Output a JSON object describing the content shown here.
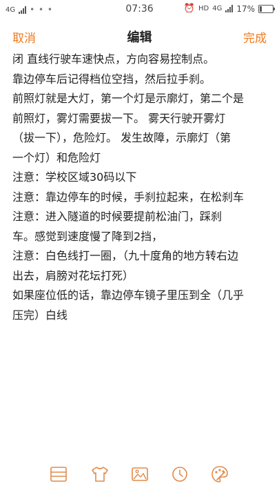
{
  "status_bar": {
    "network_left": "4G",
    "time": "07:36",
    "hd": "HD",
    "network_right": "4G",
    "battery": "17%",
    "battery_level": 0.17
  },
  "nav": {
    "cancel_label": "取消",
    "title": "编辑",
    "done_label": "完成"
  },
  "note": {
    "lines": [
      "闭 直线行驶车速快点，方向容易控制点。",
      "靠边停车后记得档位空挡，然后拉手刹。",
      "前照灯就是大灯，第一个灯是示廓灯，第二个是",
      "前照灯，雾灯需要拔一下。 雾天行驶开雾灯",
      "（拔一下），危险灯。 发生故障，示廓灯（第",
      "一个灯）和危险灯",
      "注意：学校区域30码以下",
      "注意：靠边停车的时候，手刹拉起来，在松刹车",
      " 注意：进入隧道的时候要提前松油门，踩刹",
      "车。感觉到速度慢了降到2挡，",
      "注意：白色线打一圈，（九十度角的地方转右边",
      "出去，肩膀对花坛打死）",
      "如果座位低的话，靠边停车镜子里压到全（几乎",
      "压完）白线"
    ]
  },
  "toolbar": {
    "icons": [
      "list-icon",
      "shirt-icon",
      "image-icon",
      "clock-icon",
      "palette-icon"
    ]
  },
  "colors": {
    "accent": "#f07a1c",
    "text": "#222222",
    "background": "#ffffff"
  }
}
